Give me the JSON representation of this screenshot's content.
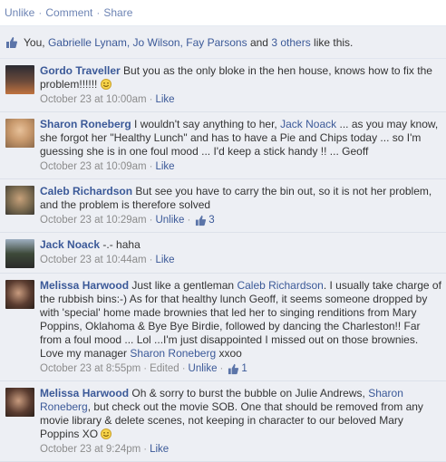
{
  "topbar": {
    "unlike": "Unlike",
    "comment": "Comment",
    "share": "Share",
    "separator": "·"
  },
  "likes": {
    "prefix": "You,",
    "names": [
      "Gabrielle Lynam,",
      "Jo Wilson,",
      "Fay Parsons"
    ],
    "and": "and",
    "others_link": "3 others",
    "suffix": "like this."
  },
  "comments": [
    {
      "author": "Gordo Traveller",
      "text": "But you as the only bloke in the hen house, knows how to fix the problem!!!!!!",
      "has_smiley": true,
      "time": "October 23 at 10:00am",
      "action": "Like",
      "avatar_color": "#6b4a3a"
    },
    {
      "author": "Sharon Roneberg",
      "text_before": "I wouldn't say anything to her,",
      "mention": "Jack Noack",
      "text_after": "... as you may know, she forgot her \"Healthy Lunch\" and has to have a Pie and Chips today ... so I'm guessing she is in one foul mood ... I'd keep a stick handy !! ... Geoff",
      "time": "October 23 at 10:09am",
      "action": "Like",
      "avatar_color": "#c99a6e"
    },
    {
      "author": "Caleb Richardson",
      "text": "But see you have to carry the bin out, so it is not her problem, and the problem is therefore solved",
      "time": "October 23 at 10:29am",
      "action": "Unlike",
      "like_count": "3",
      "avatar_color": "#7a6a4f"
    },
    {
      "author": "Jack Noack",
      "text": "-.- haha",
      "time": "October 23 at 10:44am",
      "action": "Like",
      "avatar_color": "#3e4a3a"
    },
    {
      "author": "Melissa Harwood",
      "text_before": "Just like a gentleman",
      "mention": "Caleb Richardson",
      "text_after": ". I usually take charge of the rubbish bins:-) As for that healthy lunch Geoff, it seems someone dropped by with 'special' home made brownies that led her to singing renditions from Mary Poppins, Oklahoma & Bye Bye Birdie, followed by dancing the Charleston!! Far from a foul mood ... Lol ...I'm just disappointed I missed out on those brownies. Love my manager",
      "mention2": "Sharon Roneberg",
      "text_end": "xxoo",
      "time": "October 23 at 8:55pm",
      "edited": "Edited",
      "action": "Unlike",
      "like_count": "1",
      "avatar_color": "#5a3c30"
    },
    {
      "author": "Melissa Harwood",
      "text_before": "Oh & sorry to burst the bubble on Julie Andrews,",
      "mention": "Sharon Roneberg",
      "text_after": ", but check out the movie SOB. One that should be removed from any movie library & delete scenes, not keeping in character to our beloved Mary Poppins XO",
      "has_smiley": true,
      "time": "October 23 at 9:24pm",
      "action": "Like",
      "avatar_color": "#5a3c30"
    }
  ]
}
